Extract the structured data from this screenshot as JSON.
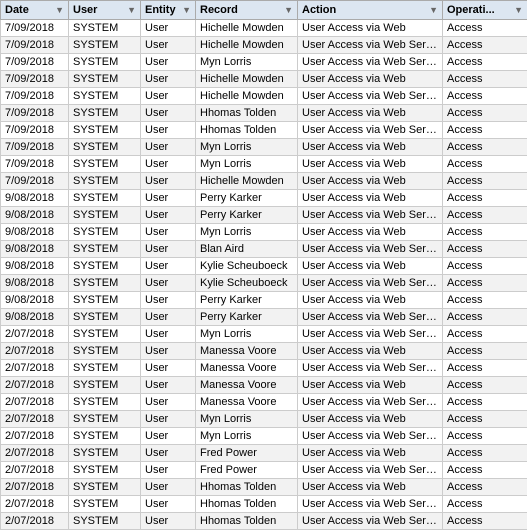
{
  "table": {
    "columns": [
      {
        "key": "date",
        "label": "Date",
        "hasFilter": true
      },
      {
        "key": "user",
        "label": "User",
        "hasFilter": true
      },
      {
        "key": "entity",
        "label": "Entity",
        "hasFilter": true
      },
      {
        "key": "record",
        "label": "Record",
        "hasFilter": true
      },
      {
        "key": "action",
        "label": "Action",
        "hasFilter": true
      },
      {
        "key": "operat",
        "label": "Operati...",
        "hasFilter": true
      }
    ],
    "rows": [
      {
        "date": "7/09/2018",
        "user": "SYSTEM",
        "entity": "User",
        "record": "Hichelle Mowden",
        "action": "User Access via Web",
        "operat": "Access"
      },
      {
        "date": "7/09/2018",
        "user": "SYSTEM",
        "entity": "User",
        "record": "Hichelle Mowden",
        "action": "User Access via Web Services",
        "operat": "Access"
      },
      {
        "date": "7/09/2018",
        "user": "SYSTEM",
        "entity": "User",
        "record": "Myn Lorris",
        "action": "User Access via Web Services",
        "operat": "Access"
      },
      {
        "date": "7/09/2018",
        "user": "SYSTEM",
        "entity": "User",
        "record": "Hichelle Mowden",
        "action": "User Access via Web",
        "operat": "Access"
      },
      {
        "date": "7/09/2018",
        "user": "SYSTEM",
        "entity": "User",
        "record": "Hichelle Mowden",
        "action": "User Access via Web Services",
        "operat": "Access"
      },
      {
        "date": "7/09/2018",
        "user": "SYSTEM",
        "entity": "User",
        "record": "Hhomas Tolden",
        "action": "User Access via Web",
        "operat": "Access"
      },
      {
        "date": "7/09/2018",
        "user": "SYSTEM",
        "entity": "User",
        "record": "Hhomas Tolden",
        "action": "User Access via Web Services",
        "operat": "Access"
      },
      {
        "date": "7/09/2018",
        "user": "SYSTEM",
        "entity": "User",
        "record": "Myn Lorris",
        "action": "User Access via Web",
        "operat": "Access"
      },
      {
        "date": "7/09/2018",
        "user": "SYSTEM",
        "entity": "User",
        "record": "Myn Lorris",
        "action": "User Access via Web",
        "operat": "Access"
      },
      {
        "date": "7/09/2018",
        "user": "SYSTEM",
        "entity": "User",
        "record": "Hichelle Mowden",
        "action": "User Access via Web",
        "operat": "Access"
      },
      {
        "date": "9/08/2018",
        "user": "SYSTEM",
        "entity": "User",
        "record": "Perry Karker",
        "action": "User Access via Web",
        "operat": "Access"
      },
      {
        "date": "9/08/2018",
        "user": "SYSTEM",
        "entity": "User",
        "record": "Perry Karker",
        "action": "User Access via Web Services",
        "operat": "Access"
      },
      {
        "date": "9/08/2018",
        "user": "SYSTEM",
        "entity": "User",
        "record": "Myn Lorris",
        "action": "User Access via Web",
        "operat": "Access"
      },
      {
        "date": "9/08/2018",
        "user": "SYSTEM",
        "entity": "User",
        "record": "Blan Aird",
        "action": "User Access via Web Services",
        "operat": "Access"
      },
      {
        "date": "9/08/2018",
        "user": "SYSTEM",
        "entity": "User",
        "record": "Kylie Scheuboeck",
        "action": "User Access via Web",
        "operat": "Access"
      },
      {
        "date": "9/08/2018",
        "user": "SYSTEM",
        "entity": "User",
        "record": "Kylie Scheuboeck",
        "action": "User Access via Web Services",
        "operat": "Access"
      },
      {
        "date": "9/08/2018",
        "user": "SYSTEM",
        "entity": "User",
        "record": "Perry Karker",
        "action": "User Access via Web",
        "operat": "Access"
      },
      {
        "date": "9/08/2018",
        "user": "SYSTEM",
        "entity": "User",
        "record": "Perry Karker",
        "action": "User Access via Web Services",
        "operat": "Access"
      },
      {
        "date": "2/07/2018",
        "user": "SYSTEM",
        "entity": "User",
        "record": "Myn Lorris",
        "action": "User Access via Web Services",
        "operat": "Access"
      },
      {
        "date": "2/07/2018",
        "user": "SYSTEM",
        "entity": "User",
        "record": "Manessa Voore",
        "action": "User Access via Web",
        "operat": "Access"
      },
      {
        "date": "2/07/2018",
        "user": "SYSTEM",
        "entity": "User",
        "record": "Manessa Voore",
        "action": "User Access via Web Services",
        "operat": "Access"
      },
      {
        "date": "2/07/2018",
        "user": "SYSTEM",
        "entity": "User",
        "record": "Manessa Voore",
        "action": "User Access via Web",
        "operat": "Access"
      },
      {
        "date": "2/07/2018",
        "user": "SYSTEM",
        "entity": "User",
        "record": "Manessa Voore",
        "action": "User Access via Web Services",
        "operat": "Access"
      },
      {
        "date": "2/07/2018",
        "user": "SYSTEM",
        "entity": "User",
        "record": "Myn Lorris",
        "action": "User Access via Web",
        "operat": "Access"
      },
      {
        "date": "2/07/2018",
        "user": "SYSTEM",
        "entity": "User",
        "record": "Myn Lorris",
        "action": "User Access via Web Services",
        "operat": "Access"
      },
      {
        "date": "2/07/2018",
        "user": "SYSTEM",
        "entity": "User",
        "record": "Fred Power",
        "action": "User Access via Web",
        "operat": "Access"
      },
      {
        "date": "2/07/2018",
        "user": "SYSTEM",
        "entity": "User",
        "record": "Fred Power",
        "action": "User Access via Web Services",
        "operat": "Access"
      },
      {
        "date": "2/07/2018",
        "user": "SYSTEM",
        "entity": "User",
        "record": "Hhomas Tolden",
        "action": "User Access via Web",
        "operat": "Access"
      },
      {
        "date": "2/07/2018",
        "user": "SYSTEM",
        "entity": "User",
        "record": "Hhomas Tolden",
        "action": "User Access via Web Services",
        "operat": "Access"
      },
      {
        "date": "2/07/2018",
        "user": "SYSTEM",
        "entity": "User",
        "record": "Hhomas Tolden",
        "action": "User Access via Web Services",
        "operat": "Access"
      }
    ]
  }
}
